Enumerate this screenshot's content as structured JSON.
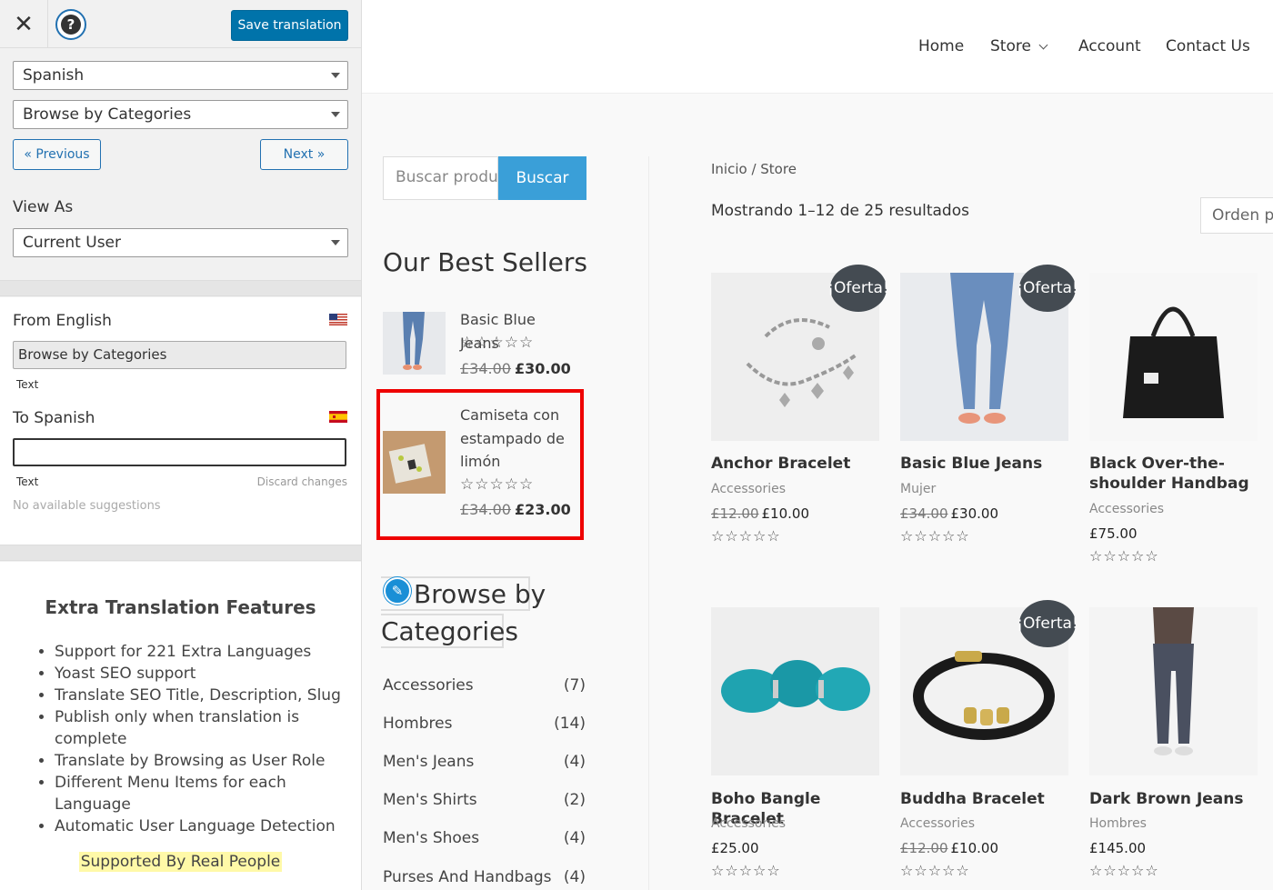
{
  "translator": {
    "save_label": "Save translation",
    "close_glyph": "✕",
    "help_glyph": "?",
    "language_select": "Spanish",
    "string_select": "Browse by Categories",
    "prev_label": "« Previous",
    "next_label": "Next »",
    "view_as_label": "View As",
    "view_as_select": "Current User",
    "from_label": "From English",
    "from_value": "Browse by Categories",
    "from_type": "Text",
    "to_label": "To Spanish",
    "to_value": "",
    "to_type": "Text",
    "discard_label": "Discard changes",
    "suggestions_label": "No available suggestions",
    "extra_title": "Extra Translation Features",
    "extra_features": [
      "Support for 221 Extra Languages",
      "Yoast SEO support",
      "Translate SEO Title, Description, Slug",
      "Publish only when translation is complete",
      "Translate by Browsing as User Role",
      "Different Menu Items for each Language",
      "Automatic User Language Detection"
    ],
    "real_people": "Supported By Real People",
    "flags": {
      "from": "us-flag",
      "to": "es-flag"
    },
    "accent_color": "#0073aa"
  },
  "site": {
    "nav": [
      "Home",
      "Store",
      "Account",
      "Contact Us"
    ],
    "search_placeholder": "Buscar productos…",
    "search_button": "Buscar",
    "best_sellers_title": "Our Best Sellers",
    "best_sellers": [
      {
        "name": "Basic Blue Jeans",
        "stars": "☆☆☆☆☆",
        "old_price": "£34.00",
        "price": "£30.00"
      },
      {
        "name": "Camiseta con estampado de limón",
        "stars": "☆☆☆☆☆",
        "old_price": "£34.00",
        "price": "£23.00"
      }
    ],
    "categories_title_line1": "Browse by",
    "categories_title_line2": "Categories",
    "categories": [
      {
        "name": "Accessories",
        "count": "(7)"
      },
      {
        "name": "Hombres",
        "count": "(14)"
      },
      {
        "name": "Men's Jeans",
        "count": "(4)"
      },
      {
        "name": "Men's Shirts",
        "count": "(2)"
      },
      {
        "name": "Men's Shoes",
        "count": "(4)"
      },
      {
        "name": "Purses And Handbags",
        "count": "(4)"
      }
    ],
    "breadcrumb": "Inicio / Store",
    "result_count": "Mostrando 1–12 de 25 resultados",
    "orderby": "Orden por defecto",
    "sale_label": "¡Oferta!",
    "products": [
      {
        "name": "Anchor Bracelet",
        "category": "Accessories",
        "old_price": "£12.00",
        "price": "£10.00",
        "stars": "☆☆☆☆☆"
      },
      {
        "name": "Basic Blue Jeans",
        "category": "Mujer",
        "old_price": "£34.00",
        "price": "£30.00",
        "stars": "☆☆☆☆☆"
      },
      {
        "name": "Black Over-the-shoulder Handbag",
        "category": "Accessories",
        "old_price": "",
        "price": "£75.00",
        "stars": "☆☆☆☆☆"
      },
      {
        "name": "Boho Bangle Bracelet",
        "category": "Accessories",
        "old_price": "",
        "price": "£25.00",
        "stars": "☆☆☆☆☆"
      },
      {
        "name": "Buddha Bracelet",
        "category": "Accessories",
        "old_price": "£12.00",
        "price": "£10.00",
        "stars": "☆☆☆☆☆"
      },
      {
        "name": "Dark Brown Jeans",
        "category": "Hombres",
        "old_price": "",
        "price": "£145.00",
        "stars": "☆☆☆☆☆"
      }
    ],
    "accent_color": "#3a9fd8",
    "highlight_color": "#ee0000"
  }
}
